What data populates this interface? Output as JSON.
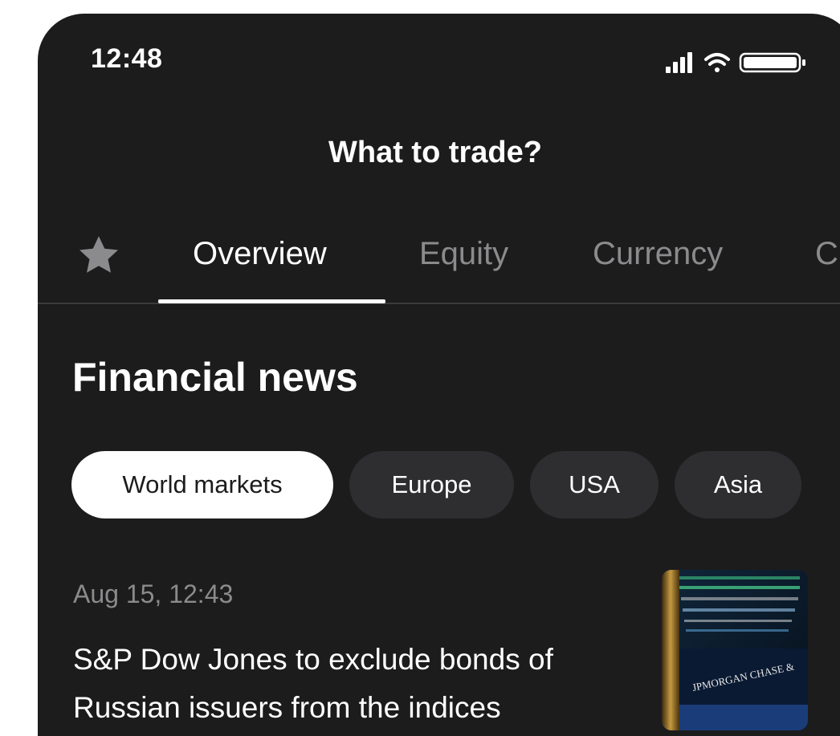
{
  "status_bar": {
    "time": "12:48",
    "icons": [
      "cellular-signal-icon",
      "wifi-icon",
      "battery-icon"
    ]
  },
  "header": {
    "title": "What to trade?"
  },
  "tabs": {
    "favorites_icon": "star-icon",
    "items": [
      {
        "label": "Overview",
        "active": true
      },
      {
        "label": "Equity",
        "active": false
      },
      {
        "label": "Currency",
        "active": false
      },
      {
        "label": "C",
        "active": false
      }
    ]
  },
  "news": {
    "section_title": "Financial news",
    "filters": [
      {
        "label": "World markets",
        "selected": true
      },
      {
        "label": "Europe",
        "selected": false
      },
      {
        "label": "USA",
        "selected": false
      },
      {
        "label": "Asia",
        "selected": false
      }
    ],
    "items": [
      {
        "date": "Aug 15, 12:43",
        "headline": "S&P Dow Jones to exclude bonds of Russian issuers from the indices",
        "image_text": "JPMORGAN CHASE &"
      }
    ]
  },
  "colors": {
    "background": "#1c1c1d",
    "chip": "#2e2e30",
    "muted_text": "#8b8b8d",
    "divider": "#3a3a3c"
  }
}
